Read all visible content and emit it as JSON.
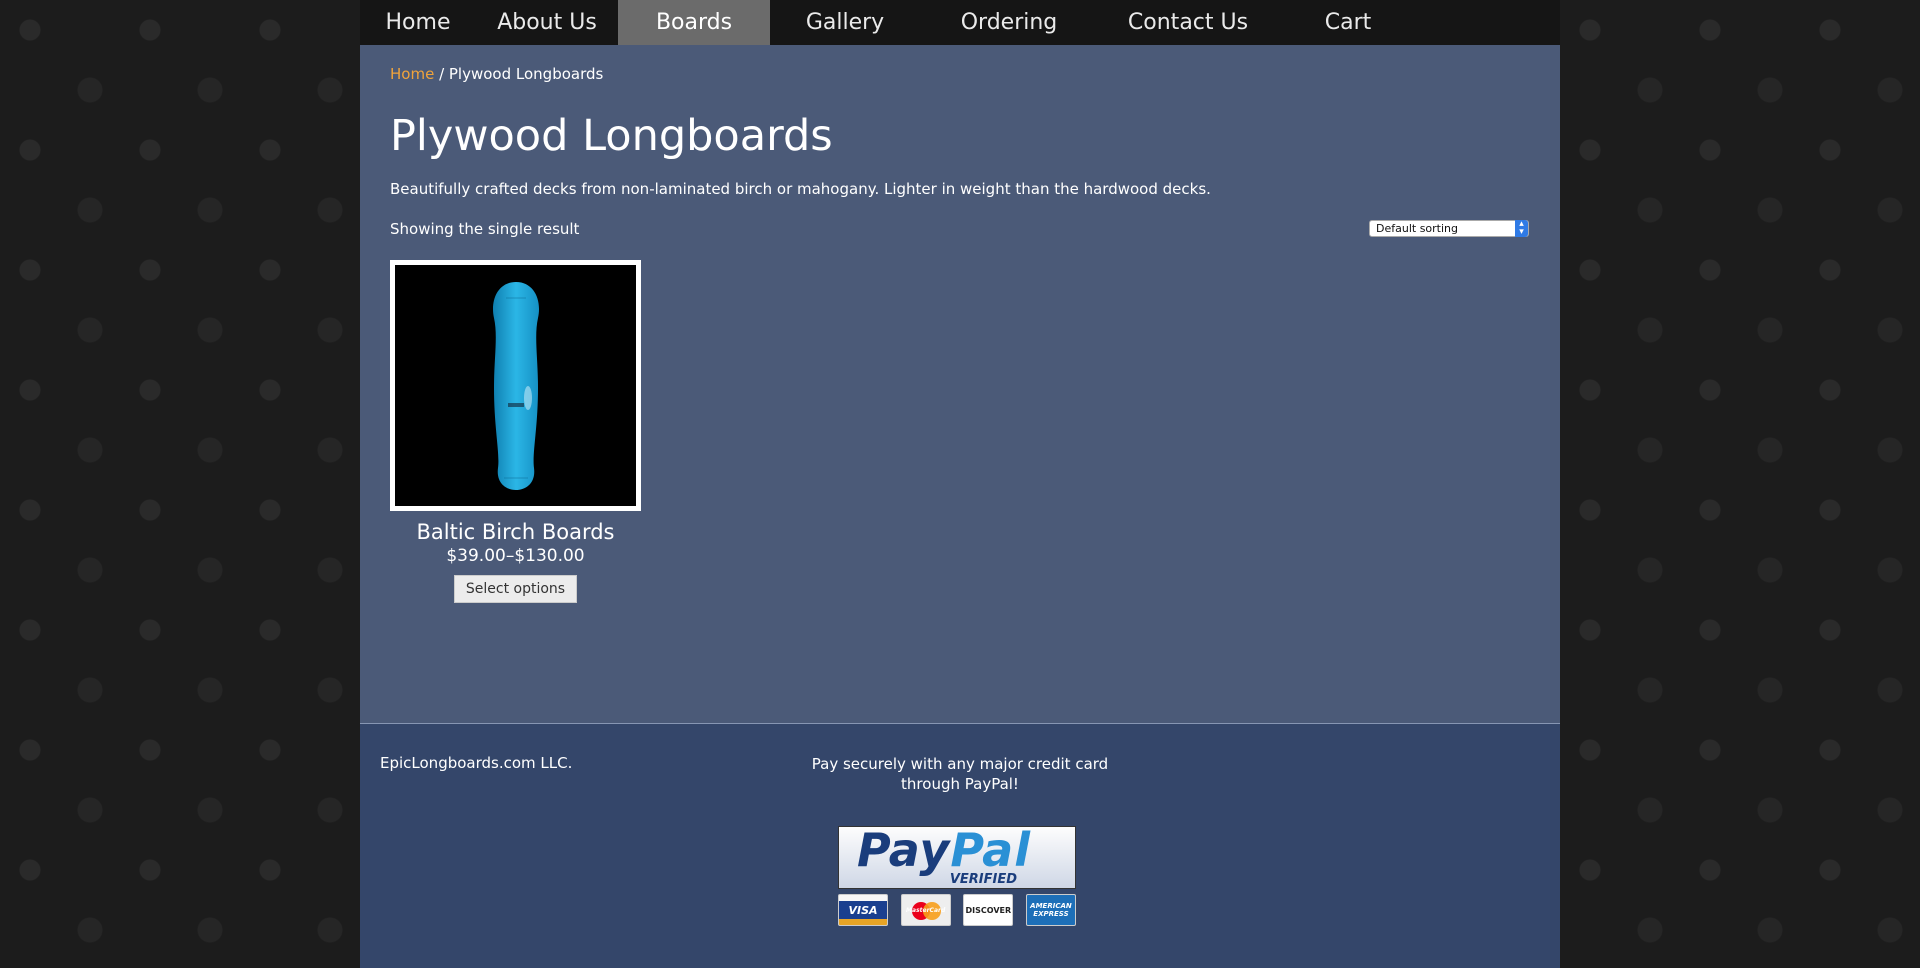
{
  "nav": {
    "items": [
      {
        "label": "Home"
      },
      {
        "label": "About Us"
      },
      {
        "label": "Boards",
        "active": true
      },
      {
        "label": "Gallery"
      },
      {
        "label": "Ordering"
      },
      {
        "label": "Contact Us"
      },
      {
        "label": "Cart"
      }
    ]
  },
  "breadcrumb": {
    "home": "Home",
    "separator": " / ",
    "current": "Plywood Longboards"
  },
  "page": {
    "title": "Plywood Longboards",
    "description": "Beautifully crafted decks from non-laminated birch or mahogany. Lighter in weight than the hardwood decks.",
    "result_count": "Showing the single result",
    "sort_selected": "Default sorting"
  },
  "products": [
    {
      "name": "Baltic Birch Boards",
      "price": "$39.00–$130.00",
      "button": "Select options",
      "image_icon": "longboard-deck-image"
    }
  ],
  "footer": {
    "company": "EpicLongboards.com LLC.",
    "pay_text": "Pay securely with any major credit card through PayPal!",
    "paypal_badge": {
      "brand_pay": "Pay",
      "brand_pal": "Pal",
      "verified": "VERIFIED"
    },
    "cards": {
      "visa": "VISA",
      "mastercard": "MasterCard",
      "discover": "DISCOVER",
      "amex": "AMERICAN EXPRESS"
    }
  },
  "colors": {
    "nav_bg": "#151515",
    "nav_active": "#6b6b6b",
    "content_bg": "#4b5a78",
    "footer_bg": "#34466a",
    "link_accent": "#f0a33b",
    "board_blue": "#1ea7d8"
  }
}
